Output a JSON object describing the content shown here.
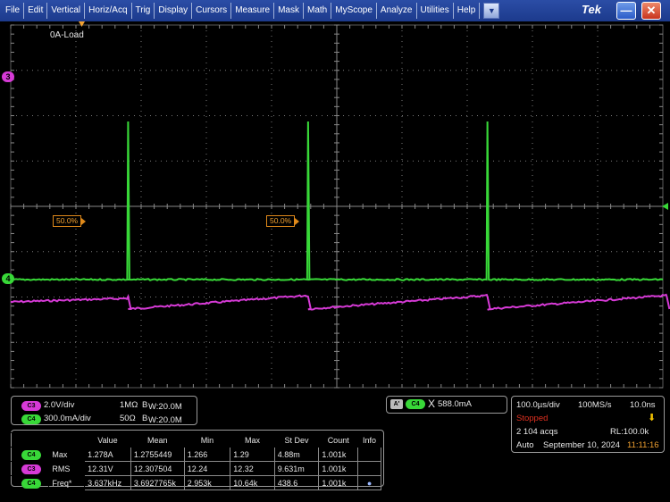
{
  "menu": {
    "items": [
      "File",
      "Edit",
      "Vertical",
      "Horiz/Acq",
      "Trig",
      "Display",
      "Cursors",
      "Measure",
      "Mask",
      "Math",
      "MyScope",
      "Analyze",
      "Utilities",
      "Help"
    ],
    "dropdown_icon": "▼",
    "brand": "Tek",
    "minimize_icon": "—",
    "close_icon": "✕"
  },
  "display": {
    "title_label": "0A-Load",
    "cursor_labels": [
      "50.0%",
      "50.0%"
    ],
    "ch3_marker": "3",
    "ch4_marker": "4",
    "colors": {
      "ch3": "#d63ad6",
      "ch4": "#38d838",
      "grid": "#7a7a7a",
      "trigger": "#f0a030"
    },
    "waveform": {
      "period_divisions": 2.75,
      "ch4_spike_positions_div": [
        1.8,
        4.56,
        7.31,
        10.06
      ]
    }
  },
  "channels": {
    "c3": {
      "badge": "C3",
      "scale": "2.0V/div",
      "impedance": "1MΩ",
      "bw": "B",
      "bw_value": "W:20.0M"
    },
    "c4": {
      "badge": "C4",
      "scale": "300.0mA/div",
      "impedance": "50Ω",
      "bw": "B",
      "bw_value": "W:20.0M"
    }
  },
  "trigger": {
    "source_badge_a": "A'",
    "source_badge": "C4",
    "slope_icon": "X",
    "level": "588.0mA"
  },
  "measurements": {
    "headers": [
      "",
      "",
      "Value",
      "Mean",
      "Min",
      "Max",
      "St Dev",
      "Count",
      "Info"
    ],
    "rows": [
      {
        "badge": "C4",
        "name": "Max",
        "value": "1.278A",
        "mean": "1.2755449",
        "min": "1.266",
        "max": "1.29",
        "stdev": "4.88m",
        "count": "1.001k",
        "info": ""
      },
      {
        "badge": "C3",
        "name": "RMS",
        "value": "12.31V",
        "mean": "12.307504",
        "min": "12.24",
        "max": "12.32",
        "stdev": "9.631m",
        "count": "1.001k",
        "info": ""
      },
      {
        "badge": "C4",
        "name": "Freq*",
        "value": "3.637kHz",
        "mean": "3.6927765k",
        "min": "2.953k",
        "max": "10.64k",
        "stdev": "438.6",
        "count": "1.001k",
        "info": "●"
      }
    ]
  },
  "acquisition": {
    "time_div": "100.0µs/div",
    "sample_rate": "100MS/s",
    "resolution": "10.0ns",
    "state": "Stopped",
    "trigger_icon": "⬇",
    "acqs": "2 104 acqs",
    "record_length": "RL:100.0k",
    "mode": "Auto",
    "date": "September 10, 2024",
    "time": "11:11:16"
  }
}
